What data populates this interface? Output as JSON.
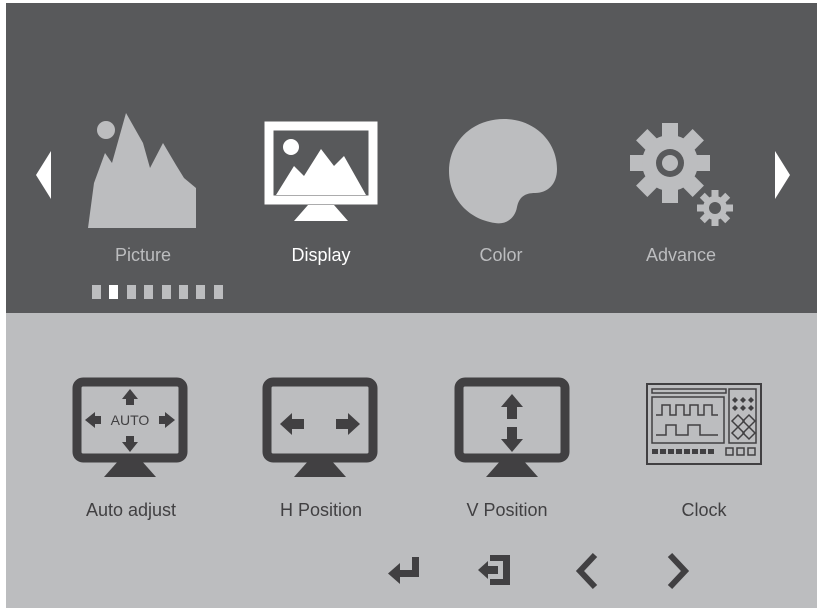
{
  "menu": {
    "items": [
      {
        "label": "Picture",
        "icon": "picture-icon",
        "active": false
      },
      {
        "label": "Display",
        "icon": "display-icon",
        "active": true
      },
      {
        "label": "Color",
        "icon": "color-palette-icon",
        "active": false
      },
      {
        "label": "Advance",
        "icon": "gears-icon",
        "active": false
      }
    ],
    "page_indicator": {
      "count": 8,
      "active_index": 1
    }
  },
  "submenu": {
    "items": [
      {
        "label": "Auto adjust",
        "icon": "auto-adjust-icon",
        "icon_text": "AUTO"
      },
      {
        "label": "H Position",
        "icon": "h-position-icon"
      },
      {
        "label": "V Position",
        "icon": "v-position-icon"
      },
      {
        "label": "Clock",
        "icon": "clock-icon"
      }
    ]
  },
  "nav_keys": [
    "enter-icon",
    "exit-icon",
    "left-icon",
    "right-icon"
  ],
  "colors": {
    "top_bg": "#58595b",
    "bottom_bg": "#bcbdbf",
    "inactive": "#bcbdbf",
    "active": "#ffffff",
    "dark_icon": "#414042"
  }
}
